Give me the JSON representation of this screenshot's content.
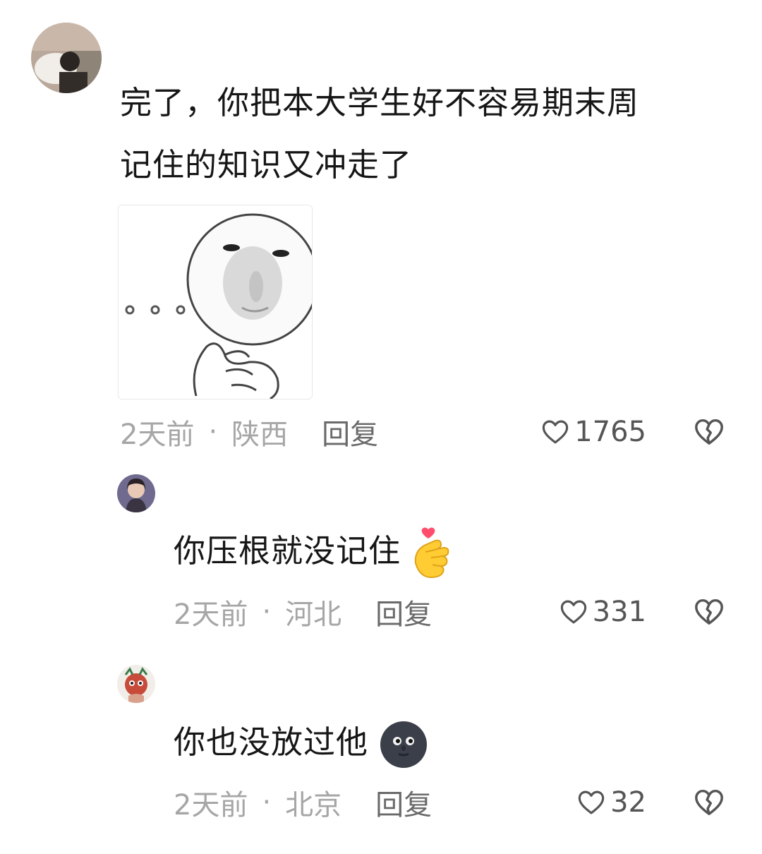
{
  "comments": [
    {
      "text_line1": "完了，你把本大学生好不容易期末周",
      "text_line2": "记住的知识又冲走了",
      "time": "2天前",
      "sep": "·",
      "location": "陕西",
      "reply_label": "回复",
      "likes": "1765"
    },
    {
      "text": "你压根就没记住",
      "emoji": "finger-heart-emoji",
      "time": "2天前",
      "sep": "·",
      "location": "河北",
      "reply_label": "回复",
      "likes": "331"
    },
    {
      "text": "你也没放过他",
      "emoji": "new-moon-face-emoji",
      "time": "2天前",
      "sep": "·",
      "location": "北京",
      "reply_label": "回复",
      "likes": "32"
    }
  ],
  "colors": {
    "meta": "#a6a6a6",
    "reply": "#6a6a6a",
    "text": "#161616",
    "icon": "#555555"
  },
  "icons": {
    "like": "heart-outline-icon",
    "dislike": "broken-heart-icon"
  }
}
